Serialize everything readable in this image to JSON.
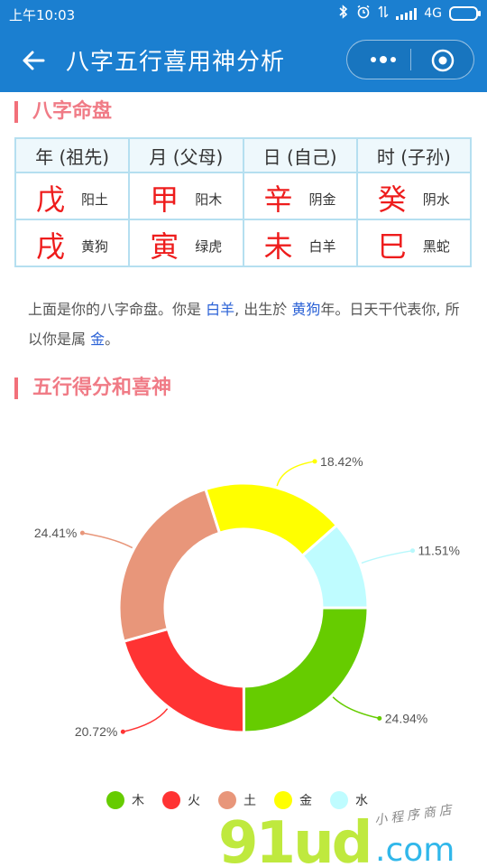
{
  "status": {
    "time": "上午10:03",
    "network": "4G"
  },
  "nav": {
    "title": "八字五行喜用神分析"
  },
  "sections": {
    "bazi_title": "八字命盘",
    "wuxing_title": "五行得分和喜神"
  },
  "bazi": {
    "headers": [
      "年 (祖先)",
      "月 (父母)",
      "日 (自己)",
      "时 (子孙)"
    ],
    "stems": [
      {
        "char": "戊",
        "label": "阳土"
      },
      {
        "char": "甲",
        "label": "阳木"
      },
      {
        "char": "辛",
        "label": "阴金"
      },
      {
        "char": "癸",
        "label": "阴水"
      }
    ],
    "branches": [
      {
        "char": "戌",
        "label": "黄狗"
      },
      {
        "char": "寅",
        "label": "绿虎"
      },
      {
        "char": "未",
        "label": "白羊"
      },
      {
        "char": "巳",
        "label": "黑蛇"
      }
    ]
  },
  "description": {
    "part1": "上面是你的八字命盘。你是 ",
    "animal": "白羊",
    "part2": ", 出生於 ",
    "year": "黄狗",
    "part3": "年。日天干代表你, 所以你是属 ",
    "element": "金",
    "part4": "。"
  },
  "chart_data": {
    "type": "pie",
    "title": "",
    "series": [
      {
        "name": "木",
        "value": 24.94,
        "label": "24.94%",
        "color": "#66cc00"
      },
      {
        "name": "火",
        "value": 20.72,
        "label": "20.72%",
        "color": "#ff3333"
      },
      {
        "name": "土",
        "value": 24.41,
        "label": "24.41%",
        "color": "#e8967a"
      },
      {
        "name": "金",
        "value": 18.42,
        "label": "18.42%",
        "color": "#ffff00"
      },
      {
        "name": "水",
        "value": 11.51,
        "label": "11.51%",
        "color": "#bffcff"
      }
    ],
    "legend_position": "bottom"
  },
  "watermark": {
    "logo": "91ud.com",
    "tagline": "小程序商店"
  },
  "colors": {
    "brand": "#1b7fd0",
    "section_title": "#f07b86",
    "table_border": "#b5dff0",
    "highlight_char": "#ee1c1c",
    "link_text": "#2a61d6"
  }
}
